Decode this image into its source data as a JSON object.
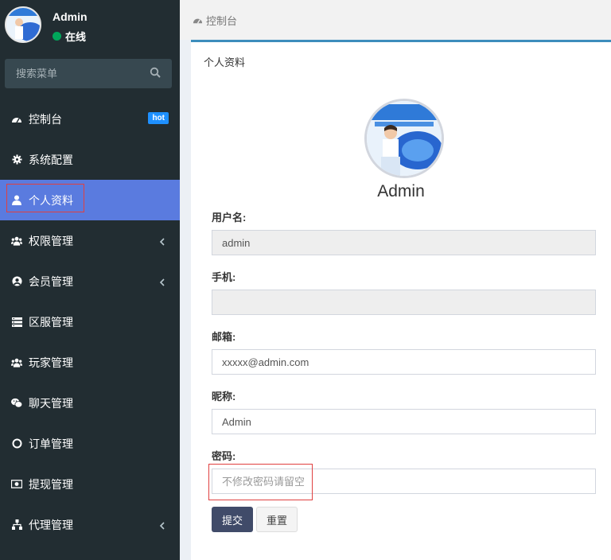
{
  "sidebar": {
    "user": {
      "name": "Admin",
      "status": "在线"
    },
    "search": {
      "placeholder": "搜索菜单"
    },
    "items": [
      {
        "label": "控制台",
        "icon": "dashboard-icon",
        "badge": "hot"
      },
      {
        "label": "系统配置",
        "icon": "gear-icon"
      },
      {
        "label": "个人资料",
        "icon": "user-icon",
        "active": true
      },
      {
        "label": "权限管理",
        "icon": "users-icon",
        "expandable": true
      },
      {
        "label": "会员管理",
        "icon": "user-circle-icon",
        "expandable": true
      },
      {
        "label": "区服管理",
        "icon": "server-icon"
      },
      {
        "label": "玩家管理",
        "icon": "users-icon"
      },
      {
        "label": "聊天管理",
        "icon": "wechat-icon"
      },
      {
        "label": "订单管理",
        "icon": "circle-icon"
      },
      {
        "label": "提现管理",
        "icon": "money-icon"
      },
      {
        "label": "代理管理",
        "icon": "sitemap-icon",
        "expandable": true
      }
    ]
  },
  "breadcrumb": {
    "label": "控制台"
  },
  "profile": {
    "title": "个人资料",
    "name": "Admin",
    "fields": {
      "username": {
        "label": "用户名:",
        "value": "admin"
      },
      "phone": {
        "label": "手机:",
        "value": ""
      },
      "email": {
        "label": "邮箱:",
        "value": "xxxxx@admin.com"
      },
      "nickname": {
        "label": "昵称:",
        "value": "Admin"
      },
      "password": {
        "label": "密码:",
        "placeholder": "不修改密码请留空"
      }
    },
    "submit_label": "提交",
    "reset_label": "重置"
  },
  "colors": {
    "sidebar_bg": "#222d32",
    "active_item": "#5a7bdf",
    "status_online": "#00a65a",
    "hot_badge": "#1e90ff",
    "submit_btn": "#404b69",
    "box_top": "#3c8dbc"
  }
}
